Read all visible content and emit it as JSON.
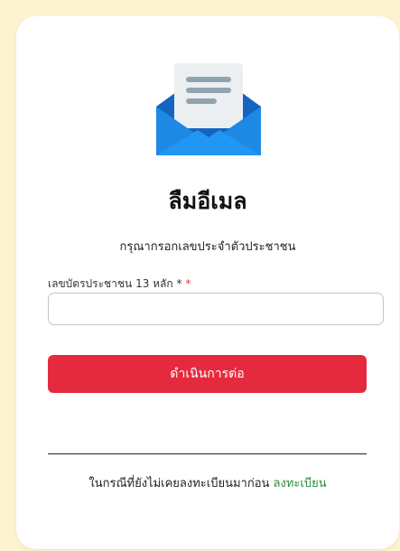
{
  "page": {
    "title": "ลืมอีเมล",
    "subtitle": "กรุณากรอกเลขประจำตัวประชาชน"
  },
  "form": {
    "id_label": "เลขบัตรประชาชน 13 หลัก *",
    "required_mark": "*",
    "id_value": "",
    "id_placeholder": "",
    "submit_label": "ดำเนินการต่อ"
  },
  "footer": {
    "text": "ในกรณีที่ยังไม่เคยลงทะเบียนมาก่อน",
    "register_link": "ลงทะเบียน"
  },
  "icons": {
    "envelope": "open-envelope-icon"
  },
  "colors": {
    "background": "#fdf3d0",
    "card": "#ffffff",
    "primary_button": "#e62a3e",
    "required": "#e0313f",
    "link": "#2e8b3a",
    "envelope_blue": "#1e88e5",
    "envelope_dark": "#1565c0",
    "letter_paper": "#eceff1",
    "letter_lines": "#90a4ae"
  }
}
